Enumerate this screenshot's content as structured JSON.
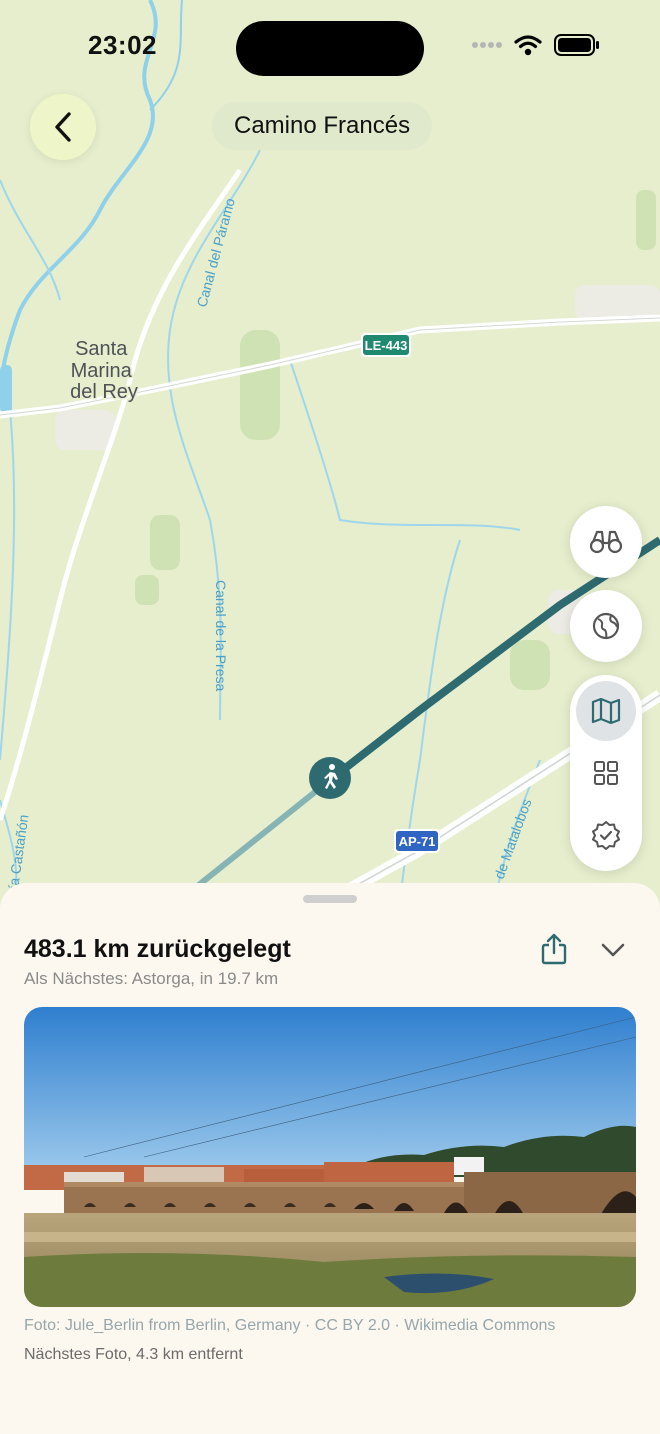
{
  "status_bar": {
    "time": "23:02"
  },
  "header": {
    "route_title": "Camino Francés"
  },
  "map": {
    "place_label_lines": [
      "Santa",
      "Marina",
      "del Rey"
    ],
    "road_badges": [
      {
        "label": "LE-443",
        "color": "#1f8a70"
      },
      {
        "label": "AP-71",
        "color": "#2f66c4"
      }
    ],
    "canal_labels": [
      "Canal del Páramo",
      "Canal de la Presa",
      "de Matalobos",
      "ía Castañón"
    ],
    "colors": {
      "land": "#e6eecd",
      "route": "#2e6b70",
      "water": "#8fd0ea",
      "road": "#ffffff"
    }
  },
  "controls": {
    "side_buttons": [
      "binoculars-icon",
      "globe-icon"
    ],
    "view_modes": [
      "map-icon",
      "grid-icon",
      "badge-check-icon"
    ],
    "active_view_mode": "map-icon"
  },
  "sheet": {
    "distance_title": "483.1 km zurückgelegt",
    "next_stop": "Als Nächstes: Astorga, in 19.7 km",
    "photo_credit": "Foto: Jule_Berlin from Berlin, Germany · CC BY 2.0 · Wikimedia Commons",
    "next_photo": "Nächstes Foto, 4.3 km entfernt"
  }
}
